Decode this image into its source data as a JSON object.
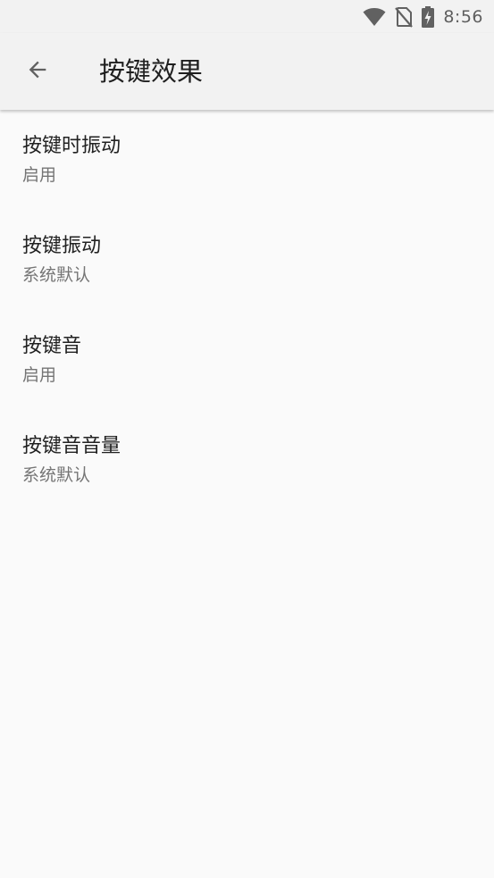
{
  "status_bar": {
    "time": "8:56",
    "icons": [
      "wifi-icon",
      "no-sim-icon",
      "battery-charging-icon"
    ]
  },
  "app_bar": {
    "back_icon": "arrow-back-icon",
    "title": "按键效果"
  },
  "preferences": [
    {
      "title": "按键时振动",
      "summary": "启用"
    },
    {
      "title": "按键振动",
      "summary": "系统默认"
    },
    {
      "title": "按键音",
      "summary": "启用"
    },
    {
      "title": "按键音音量",
      "summary": "系统默认"
    }
  ],
  "colors": {
    "background": "#fafafa",
    "bar": "#f2f2f2",
    "title_text": "#212121",
    "summary_text": "#757575",
    "icon": "#616161"
  }
}
